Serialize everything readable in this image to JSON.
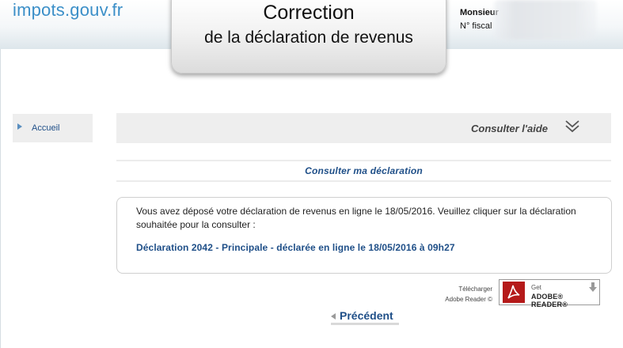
{
  "header": {
    "logo": "impots.gouv.fr",
    "title_main": "Correction",
    "title_sub": "de la déclaration de revenus",
    "user_name": "Monsieur",
    "user_fiscal": "N° fiscal"
  },
  "sidebar": {
    "items": [
      {
        "label": "Accueil"
      }
    ]
  },
  "help": {
    "label": "Consulter l'aide",
    "icon": "double-chevron-down-icon"
  },
  "main": {
    "section_title": "Consulter ma déclaration",
    "message": "Vous avez déposé votre déclaration de revenus en ligne le 18/05/2016. Veuillez cliquer sur la déclaration souhaitée pour la consulter :",
    "declaration_link": "Déclaration 2042 - Principale - déclarée en ligne le 18/05/2016 à 09h27"
  },
  "adobe": {
    "caption_line1": "Télécharger",
    "caption_line2": "Adobe Reader ©",
    "badge_get": "Get",
    "badge_name": "ADOBE® READER®"
  },
  "nav": {
    "previous_label": "Précédent"
  },
  "colors": {
    "link_blue": "#1f4f88",
    "logo_blue": "#3b8fc8",
    "adobe_red": "#b51a1a"
  }
}
